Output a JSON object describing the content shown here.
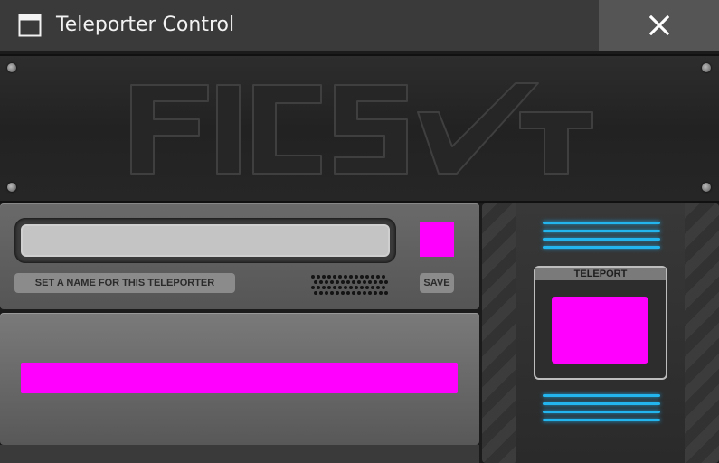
{
  "window": {
    "title": "Teleporter Control",
    "close_glyph": "✕"
  },
  "banner": {
    "logo_text": "FICSIT"
  },
  "name_panel": {
    "name_value": "",
    "hint_label": "SET A NAME FOR THIS TELEPORTER",
    "save_label": "SAVE",
    "swatch_color": "#ff00ff"
  },
  "destination_panel": {
    "bar_color": "#ff00ff"
  },
  "teleport_panel": {
    "label": "TELEPORT",
    "button_color": "#ff00ff",
    "light_color": "#23b6ee"
  },
  "icons": {
    "window": "window-icon",
    "close": "close-icon",
    "speaker": "speaker-grille-icon"
  }
}
